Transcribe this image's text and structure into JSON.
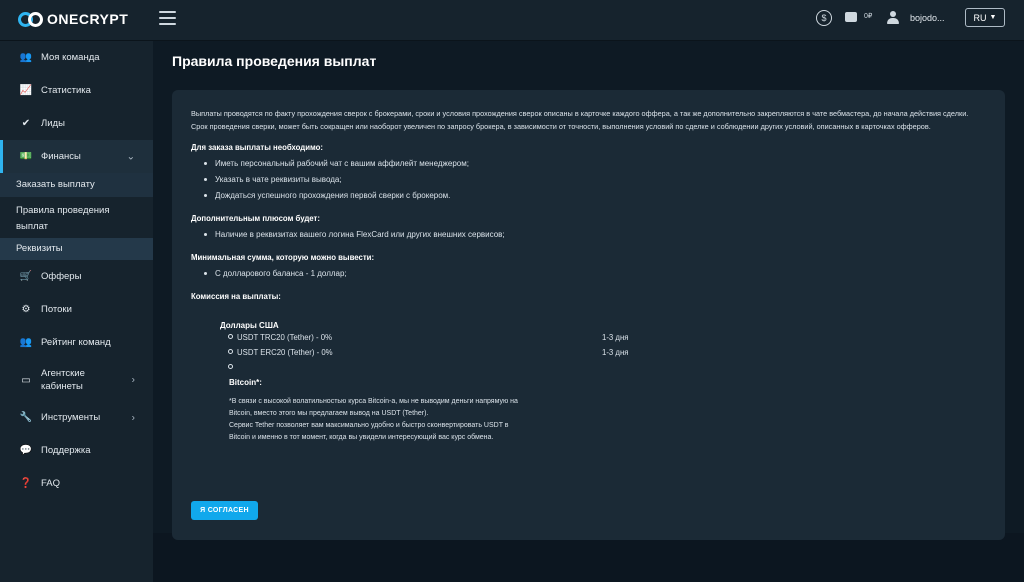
{
  "app": {
    "logo_text": "ONECRYPT"
  },
  "header": {
    "balance_value": "0₽",
    "username": "bojodo...",
    "lang": "RU"
  },
  "sidebar": {
    "items": [
      {
        "label": "Моя команда",
        "icon": "team-icon"
      },
      {
        "label": "Статистика",
        "icon": "stats-icon"
      },
      {
        "label": "Лиды",
        "icon": "check-icon"
      },
      {
        "label": "Финансы",
        "icon": "money-icon"
      },
      {
        "label": "Офферы",
        "icon": "cart-icon"
      },
      {
        "label": "Потоки",
        "icon": "flows-icon"
      },
      {
        "label": "Рейтинг команд",
        "icon": "rating-icon"
      },
      {
        "label": "Агентские кабинеты",
        "icon": "cabinet-icon"
      },
      {
        "label": "Инструменты",
        "icon": "tools-icon"
      },
      {
        "label": "Поддержка",
        "icon": "support-icon"
      },
      {
        "label": "FAQ",
        "icon": "faq-icon"
      }
    ],
    "finance_sub": [
      {
        "label": "Заказать выплату"
      },
      {
        "label": "Правила проведения выплат"
      },
      {
        "label": "Реквизиты"
      }
    ]
  },
  "page": {
    "title": "Правила проведения выплат",
    "intro": "Выплаты проводятся по факту прохождения сверок с брокерами, сроки и условия прохождения сверок описаны в карточке каждого оффера, а так же дополнительно закрепляются в чате вебмастера, до начала действия сделки. Срок проведения сверки, может быть сокращен или наоборот увеличен по запросу брокера, в зависимости от точности, выполнения условий по сделке и соблюдении других условий, описанных в карточках офферов.",
    "sections": [
      {
        "heading": "Для заказа выплаты необходимо:",
        "items": [
          "Иметь персональный рабочий чат с вашим аффилейт менеджером;",
          "Указать в чате реквизиты вывода;",
          "Дождаться успешного прохождения первой сверки с брокером."
        ]
      },
      {
        "heading": "Дополнительным плюсом будет:",
        "items": [
          "Наличие в реквизитах вашего логина FlexCard или других внешних сервисов;"
        ]
      },
      {
        "heading": "Минимальная сумма, которую можно вывести:",
        "items": [
          "С долларового баланса - 1 доллар;"
        ]
      }
    ],
    "commission_heading": "Комиссия на выплаты:",
    "currency": {
      "title": "Доллары США",
      "rows": [
        {
          "name": "USDT TRC20 (Tether) - 0%",
          "time": "1-3 дня"
        },
        {
          "name": "USDT ERC20 (Tether) - 0%",
          "time": "1-3 дня"
        },
        {
          "name": "",
          "time": ""
        }
      ]
    },
    "bitcoin": {
      "title": "Bitcoin*:",
      "note_lines": [
        "*В связи с высокой волатильностью курса Bitcoin-а, мы не выводим деньги напрямую на",
        "Bitcoin, вместо этого мы предлагаем вывод на USDT (Tether).",
        "Сервис Tether позволяет вам максимально удобно и быстро сконвертировать USDT в",
        "Bitcoin и именно в тот момент, когда вы увидели интересующий вас курс обмена."
      ]
    },
    "agree_button": "Я СОГЛАСЕН"
  }
}
